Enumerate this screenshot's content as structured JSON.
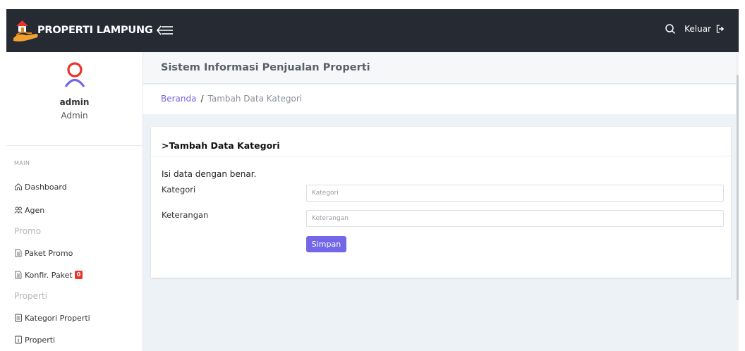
{
  "brand": {
    "name": "PROPERTI LAMPUNG"
  },
  "header": {
    "logout_label": "Keluar"
  },
  "user": {
    "name": "admin",
    "role": "Admin"
  },
  "sidebar": {
    "heading": "MAIN",
    "items": [
      {
        "label": "Dashboard",
        "icon": "home-icon"
      },
      {
        "label": "Agen",
        "icon": "users-icon"
      }
    ],
    "promo_group": "Promo",
    "promo_items": [
      {
        "label": "Paket Promo",
        "icon": "file-icon"
      },
      {
        "label": "Konfir. Paket",
        "icon": "file-icon",
        "badge": "0"
      }
    ],
    "properti_group": "Properti",
    "properti_items": [
      {
        "label": "Kategori Properti",
        "icon": "list-icon"
      },
      {
        "label": "Properti",
        "icon": "info-icon"
      }
    ]
  },
  "page": {
    "title": "Sistem Informasi Penjualan Properti",
    "breadcrumb_home": "Beranda",
    "breadcrumb_separator": "/",
    "breadcrumb_current": "Tambah Data Kategori"
  },
  "form": {
    "card_title": ">Tambah Data Kategori",
    "hint": "Isi data dengan benar.",
    "kategori_label": "Kategori",
    "kategori_placeholder": "Kategori",
    "keterangan_label": "Keterangan",
    "keterangan_placeholder": "Keterangan",
    "submit_label": "Simpan"
  },
  "colors": {
    "topbar": "#262a33",
    "accent": "#7367e8",
    "badge": "#e8352c"
  }
}
